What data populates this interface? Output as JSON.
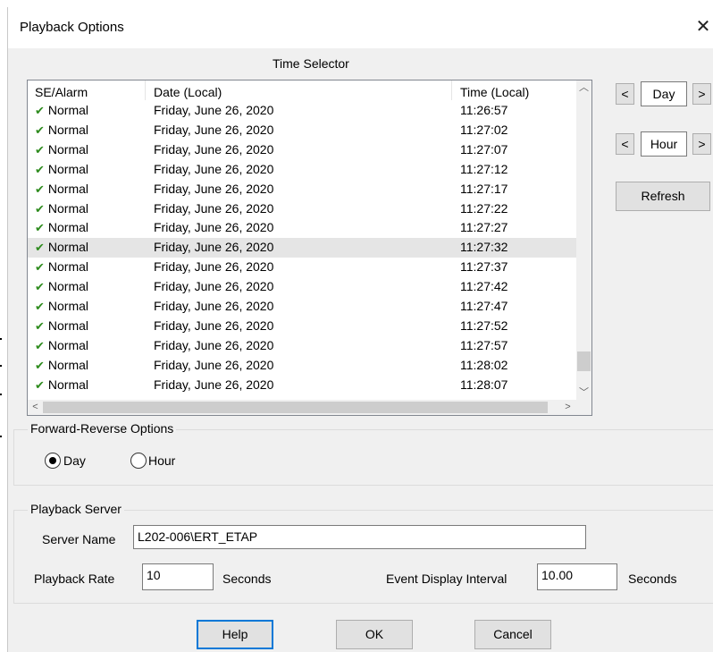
{
  "window": {
    "title": "Playback Options",
    "close_glyph": "✕"
  },
  "time_selector": {
    "label": "Time Selector",
    "columns": [
      "SE/Alarm",
      "Date (Local)",
      "Time (Local)"
    ],
    "rows": [
      {
        "status": "Normal",
        "date": "Friday, June 26, 2020",
        "time": "11:26:57"
      },
      {
        "status": "Normal",
        "date": "Friday, June 26, 2020",
        "time": "11:27:02"
      },
      {
        "status": "Normal",
        "date": "Friday, June 26, 2020",
        "time": "11:27:07"
      },
      {
        "status": "Normal",
        "date": "Friday, June 26, 2020",
        "time": "11:27:12"
      },
      {
        "status": "Normal",
        "date": "Friday, June 26, 2020",
        "time": "11:27:17"
      },
      {
        "status": "Normal",
        "date": "Friday, June 26, 2020",
        "time": "11:27:22"
      },
      {
        "status": "Normal",
        "date": "Friday, June 26, 2020",
        "time": "11:27:27"
      },
      {
        "status": "Normal",
        "date": "Friday, June 26, 2020",
        "time": "11:27:32",
        "selected": true
      },
      {
        "status": "Normal",
        "date": "Friday, June 26, 2020",
        "time": "11:27:37"
      },
      {
        "status": "Normal",
        "date": "Friday, June 26, 2020",
        "time": "11:27:42"
      },
      {
        "status": "Normal",
        "date": "Friday, June 26, 2020",
        "time": "11:27:47"
      },
      {
        "status": "Normal",
        "date": "Friday, June 26, 2020",
        "time": "11:27:52"
      },
      {
        "status": "Normal",
        "date": "Friday, June 26, 2020",
        "time": "11:27:57"
      },
      {
        "status": "Normal",
        "date": "Friday, June 26, 2020",
        "time": "11:28:02"
      },
      {
        "status": "Normal",
        "date": "Friday, June 26, 2020",
        "time": "11:28:07"
      }
    ],
    "status_icon": "checkmark-icon",
    "status_icon_color": "#2e8b1e"
  },
  "nav": {
    "day": {
      "prev": "<",
      "label": "Day",
      "next": ">"
    },
    "hour": {
      "prev": "<",
      "label": "Hour",
      "next": ">"
    },
    "refresh": "Refresh"
  },
  "forward_reverse": {
    "title": "Forward-Reverse Options",
    "options": [
      {
        "label": "Day",
        "checked": true
      },
      {
        "label": "Hour",
        "checked": false
      }
    ]
  },
  "playback_server": {
    "title": "Playback Server",
    "server_name_label": "Server Name",
    "server_name": "L202-006\\ERT_ETAP",
    "rate_label": "Playback Rate",
    "rate_value": "10",
    "rate_unit": "Seconds",
    "interval_label": "Event Display Interval",
    "interval_value": "10.00",
    "interval_unit": "Seconds"
  },
  "buttons": {
    "help": "Help",
    "ok": "OK",
    "cancel": "Cancel"
  },
  "colors": {
    "accent": "#0078d7",
    "selection": "#e5e5e5",
    "dialog_bg": "#f0f0f0"
  }
}
